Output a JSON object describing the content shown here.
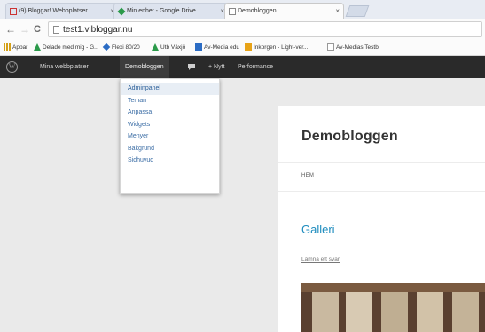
{
  "browser": {
    "tabs": [
      {
        "label": "(9) Bloggar! Webbplatser",
        "icon_color": "#c33"
      },
      {
        "label": "Min enhet - Google Drive",
        "icon_color": "#2b9a4a"
      },
      {
        "label": "Demobloggen",
        "icon_color": "#888"
      }
    ],
    "close_glyph": "×",
    "back": "←",
    "forward": "→",
    "reload": "C",
    "url": "test1.vibloggar.nu",
    "bookmarks": [
      {
        "label": "Appar",
        "icon": "apps-icon",
        "color": "#d4a017"
      },
      {
        "label": "Delade med mig - G...",
        "icon": "drive-icon",
        "color": "#2b9a4a"
      },
      {
        "label": "Flexi 80/20",
        "icon": "diamond-icon",
        "color": "#2b6cc4"
      },
      {
        "label": "Utb Växjö",
        "icon": "drive-icon",
        "color": "#2b9a4a"
      },
      {
        "label": "Av-Media edu",
        "icon": "bookmark-icon",
        "color": "#2b6cc4"
      },
      {
        "label": "Inkorgen - Light-ver...",
        "icon": "mail-icon",
        "color": "#e8a317"
      },
      {
        "label": "Av-Medias Testb",
        "icon": "page-icon",
        "color": "#999"
      }
    ]
  },
  "wpbar": {
    "my_sites": "Mina webbplatser",
    "site_name": "Demobloggen",
    "new": "+ Nytt",
    "performance": "Performance"
  },
  "dropdown": {
    "items": [
      "Adminpanel",
      "Teman",
      "Anpassa",
      "Widgets",
      "Menyer",
      "Bakgrund",
      "Sidhuvud"
    ]
  },
  "page": {
    "blog_title": "Demobloggen",
    "menu_item": "HEM",
    "post_title": "Galleri",
    "reply_link": "Lämna ett svar"
  },
  "colors": {
    "accent_link": "#3b6da5",
    "post_title": "#1e8cbe",
    "admin_bar": "#2a2a2a"
  }
}
